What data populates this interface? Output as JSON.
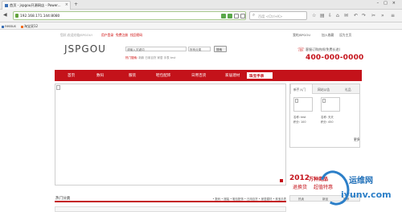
{
  "browser": {
    "tab_title": "首页 - jspgou开源网店 - Power...",
    "url": "192.168.171.144:8080",
    "search_placeholder": "百度 <Ctrl+K>",
    "bookmarks": [
      "nessus",
      "淘宝双12"
    ]
  },
  "site": {
    "topbar": {
      "greeting": "您好,欢迎光临JSPGOU!",
      "login": "用户登录",
      "register": "免费注册",
      "forgot": "找回密码",
      "my_account": "我的JSPGOU",
      "favorites": "加入收藏",
      "set_home": "设为主页"
    },
    "logo": "JSPGOU",
    "search": {
      "placeholder": "请输入关键词",
      "category": "所有分类",
      "button": "搜索"
    },
    "hot_label": "热门搜索:",
    "hot_words": "新款  日用百货  家居  手表  test",
    "hotline_label": "客服订购热线(免费长途)",
    "hotline_number": "400-000-0000",
    "menu": [
      "首页",
      "数码",
      "服装",
      "鞋包配饰",
      "日用百货",
      "家居建材",
      "珠宝手表"
    ],
    "active_menu": "珠宝手表",
    "side_tabs": [
      "新手入门",
      "网站公告",
      "礼品"
    ],
    "products": [
      {
        "name": "名称: test",
        "price": "积分: 100"
      },
      {
        "name": "名称: 天天",
        "price": "积分: 450"
      }
    ],
    "ad": {
      "year": "2012",
      "line1": "万种商品",
      "line2": "退换货",
      "line3": "超值特惠"
    },
    "more": "更多",
    "bottom_tabs": [
      "热卖",
      "新品",
      "推荐"
    ],
    "hot_category_title": "热门分类",
    "hot_category_links": "• 数码  • 服装  • 鞋包配饰  • 日用百货  • 家居建材  • 珠宝手表"
  },
  "watermark": {
    "cn": "运维网",
    "domain": "iyunv.com"
  }
}
